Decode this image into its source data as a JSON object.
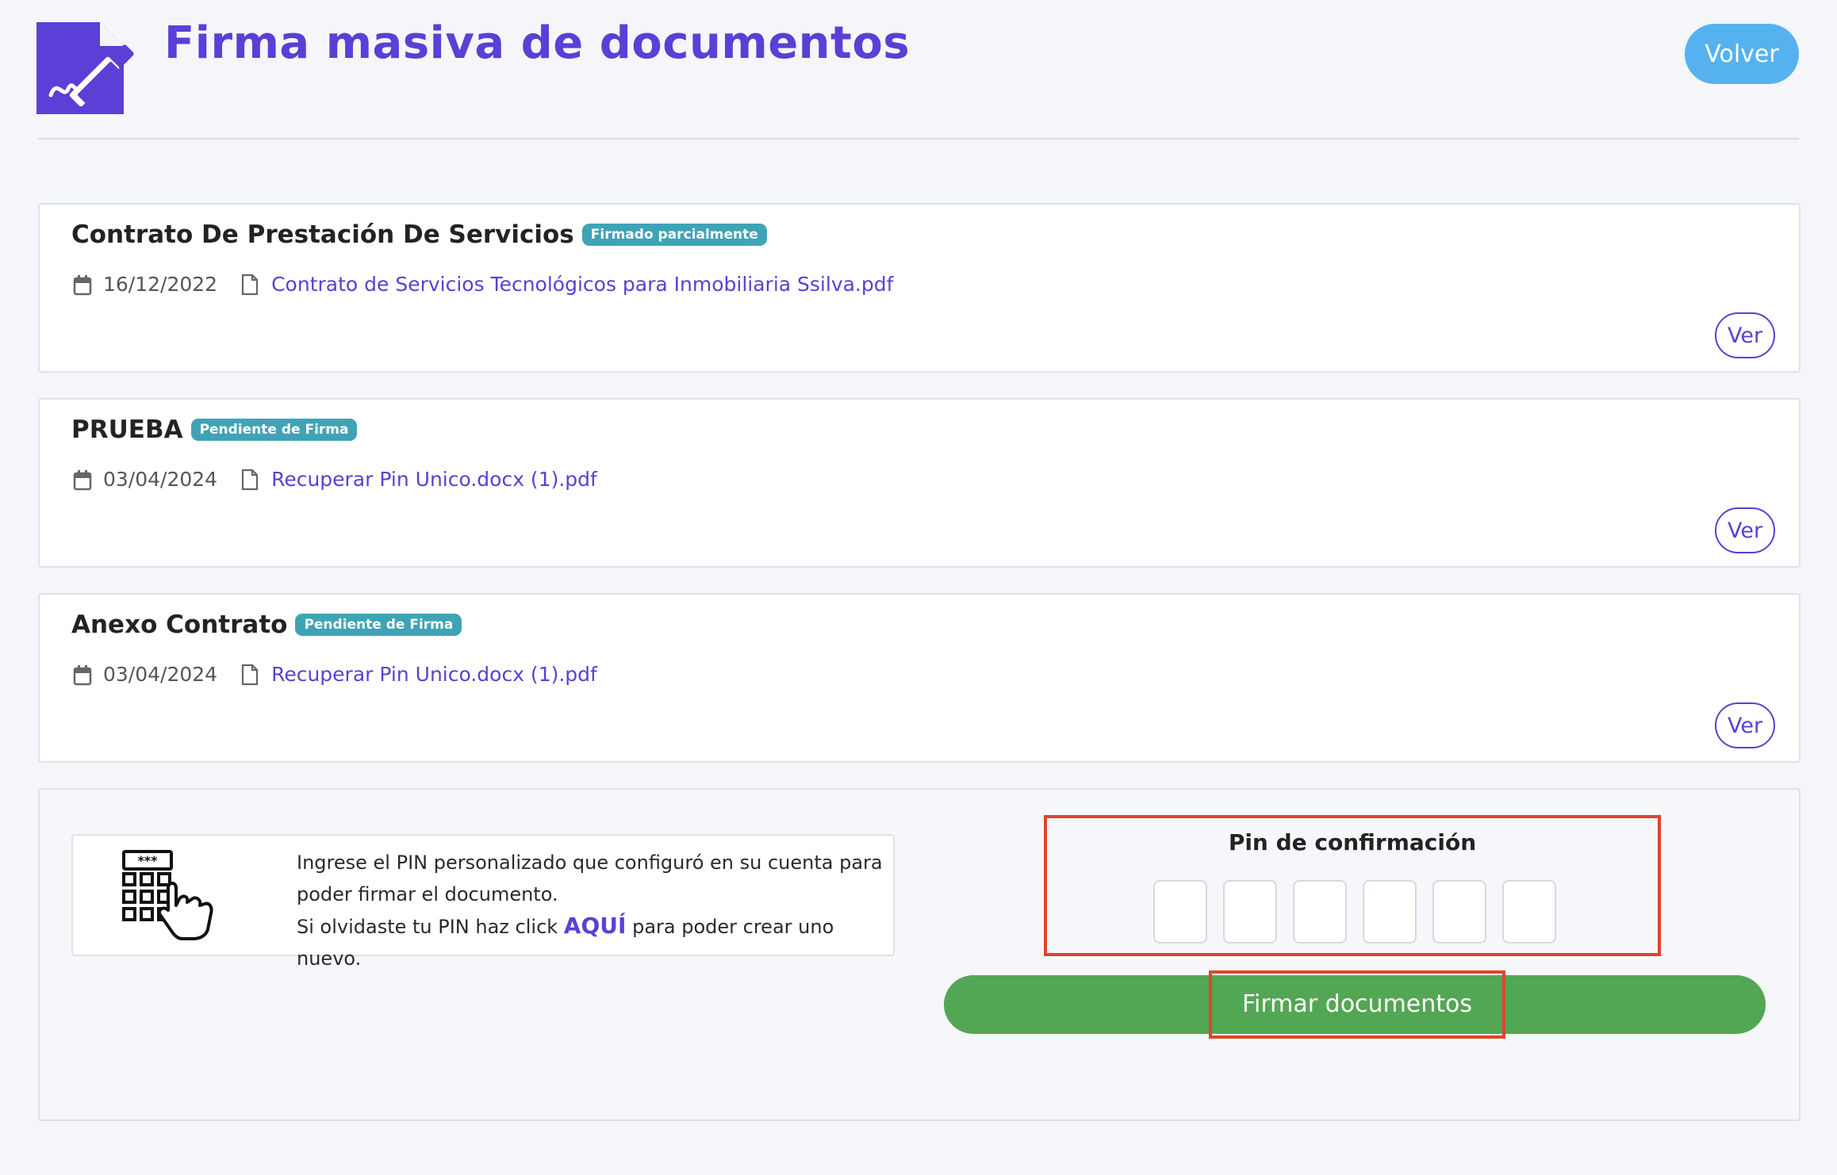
{
  "header": {
    "title": "Firma masiva de documentos",
    "back_label": "Volver",
    "icon": "document-signature-icon"
  },
  "documents": [
    {
      "title": "Contrato De Prestación De Servicios",
      "badge": "Firmado parcialmente",
      "date": "16/12/2022",
      "file": "Contrato de Servicios Tecnológicos para Inmobiliaria Ssilva.pdf",
      "view_label": "Ver"
    },
    {
      "title": "PRUEBA",
      "badge": "Pendiente de Firma",
      "date": "03/04/2024",
      "file": "Recuperar Pin Unico.docx (1).pdf",
      "view_label": "Ver"
    },
    {
      "title": "Anexo Contrato",
      "badge": "Pendiente de Firma",
      "date": "03/04/2024",
      "file": "Recuperar Pin Unico.docx (1).pdf",
      "view_label": "Ver"
    }
  ],
  "sign_panel": {
    "info_line1": "Ingrese el PIN personalizado que configuró en su cuenta para poder firmar el documento.",
    "info_line2_prefix": "Si olvidaste tu PIN haz click",
    "info_link": "AQUÍ",
    "info_line2_suffix": "para poder crear uno nuevo.",
    "pin_label": "Pin de confirmación",
    "pin_values": [
      "",
      "",
      "",
      "",
      "",
      ""
    ],
    "submit_label": "Firmar documentos",
    "keypad_icon": "keypad-touch-icon"
  },
  "colors": {
    "brand": "#5b3fd6",
    "back_button": "#56b2ef",
    "badge": "#3fa3b6",
    "submit": "#53a653",
    "highlight": "#e0432f"
  }
}
